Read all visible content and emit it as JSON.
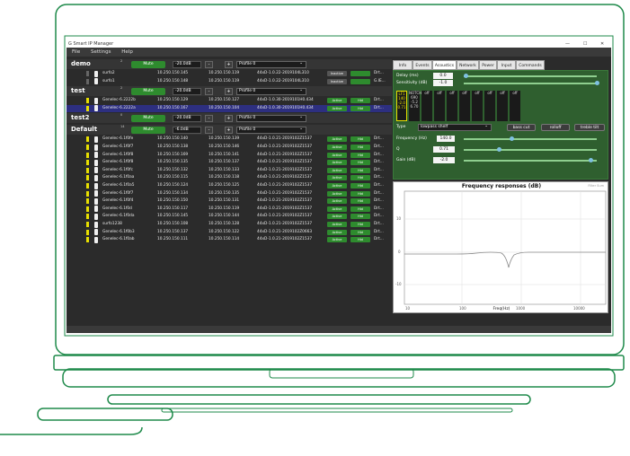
{
  "window": {
    "title": "Smart IP Manager",
    "controls": [
      "—",
      "☐",
      "✕"
    ]
  },
  "menu": [
    "File",
    "Settings",
    "Help"
  ],
  "groups": [
    {
      "name": "demo",
      "count": "2",
      "gain": "-20.0dB",
      "profile": "Profile 0",
      "devices": [
        {
          "name": "surfo2",
          "ip": "10.250.150.145",
          "ip2": "10.250.150.119",
          "fw": "44xD-1.0.22-2019104L310",
          "status1": "Inactive",
          "status2": "",
          "more": "Drt..."
        },
        {
          "name": "surfo1",
          "ip": "10.250.150.148",
          "ip2": "10.250.150.119",
          "fw": "44xD-1.0.22-2019104L310",
          "status1": "Inactive",
          "status2": "",
          "more": "G.IE..."
        }
      ]
    },
    {
      "name": "test",
      "count": "2",
      "gain": "-20.0dB",
      "profile": "Profile 0",
      "devices": [
        {
          "name": "Genelec-6.2222b",
          "ip": "10.250.150.129",
          "ip2": "10.250.150.127",
          "fw": "44xD-1.0.30-2019101H0.434",
          "status1": "Active",
          "status2": "Hid",
          "more": "Drt..."
        },
        {
          "name": "Genelec-6.2222a",
          "ip": "10.250.150.167",
          "ip2": "10.250.150.104",
          "fw": "44xD-1.0.30-2019101H0.434",
          "status1": "Active",
          "status2": "Hid",
          "more": "Drt..."
        }
      ]
    },
    {
      "name": "test2",
      "count": "0",
      "gain": "-20.0dB",
      "profile": "Profile 0",
      "devices": []
    },
    {
      "name": "Default",
      "count": "14",
      "gain": "-6.0dB",
      "profile": "Profile 0",
      "devices": [
        {
          "name": "Genelec-6.1f0fe",
          "ip": "10.250.150.140",
          "ip2": "10.250.150.139",
          "fw": "44xD-1.0.21-2019102Z1537",
          "status1": "Active",
          "status2": "Hid",
          "more": "Drt..."
        },
        {
          "name": "Genelec-6.1f0f7",
          "ip": "10.250.150.138",
          "ip2": "10.250.150.146",
          "fw": "44xD-1.0.21-2019102Z1537",
          "status1": "Active",
          "status2": "Hid",
          "more": "Drt..."
        },
        {
          "name": "Genelec-6.1f0f8",
          "ip": "10.250.150.169",
          "ip2": "10.250.150.141",
          "fw": "44xD-1.0.21-2019102Z1537",
          "status1": "Active",
          "status2": "Hid",
          "more": "Drt..."
        },
        {
          "name": "Genelec-6.1f0f8",
          "ip": "10.250.150.135",
          "ip2": "10.250.150.137",
          "fw": "44xD-1.0.21-2019102Z1537",
          "status1": "Active",
          "status2": "Hid",
          "more": "Drt..."
        },
        {
          "name": "Genelec-6.1f0fc",
          "ip": "10.250.150.132",
          "ip2": "10.250.150.133",
          "fw": "44xD-1.0.21-2019102Z1537",
          "status1": "Active",
          "status2": "Hid",
          "more": "Drt..."
        },
        {
          "name": "Genelec-6.1f0aa",
          "ip": "10.250.150.115",
          "ip2": "10.250.150.118",
          "fw": "44xD-1.0.21-2019102Z1537",
          "status1": "Active",
          "status2": "Hid",
          "more": "Drt..."
        },
        {
          "name": "Genelec-6.1f0a5",
          "ip": "10.250.150.124",
          "ip2": "10.250.150.125",
          "fw": "44xD-1.0.21-2019102Z1537",
          "status1": "Active",
          "status2": "Hid",
          "more": "Drt..."
        },
        {
          "name": "Genelec-6.1f0f7",
          "ip": "10.250.150.134",
          "ip2": "10.250.150.135",
          "fw": "44xD-1.0.21-2019102Z1537",
          "status1": "Active",
          "status2": "Hid",
          "more": "Drt..."
        },
        {
          "name": "Genelec-6.1f0f4",
          "ip": "10.250.150.150",
          "ip2": "10.250.150.131",
          "fw": "44xD-1.0.21-2019102Z1537",
          "status1": "Active",
          "status2": "Hid",
          "more": "Drt..."
        },
        {
          "name": "Genelec-6.1f0d",
          "ip": "10.250.150.117",
          "ip2": "10.250.150.119",
          "fw": "44xD-1.0.21-2019102Z1537",
          "status1": "Active",
          "status2": "Hid",
          "more": "Drt..."
        },
        {
          "name": "Genelec-6.1f0da",
          "ip": "10.250.150.145",
          "ip2": "10.250.150.144",
          "fw": "44xD-1.0.21-2019102Z1537",
          "status1": "Active",
          "status2": "Hid",
          "more": "Drt..."
        },
        {
          "name": "surfo1238",
          "ip": "10.250.150.108",
          "ip2": "10.250.150.128",
          "fw": "44xD-1.0.21-2019102Z1537",
          "status1": "Active",
          "status2": "Hid",
          "more": "Drt..."
        },
        {
          "name": "Genelec-6.1f0b3",
          "ip": "10.250.150.137",
          "ip2": "10.250.150.122",
          "fw": "44xD-1.0.21-2019102Z0663",
          "status1": "Active",
          "status2": "Hid",
          "more": "Drt..."
        },
        {
          "name": "Genelec-6.1f0ab",
          "ip": "10.250.150.111",
          "ip2": "10.250.150.114",
          "fw": "44xD-1.0.21-2019102Z1537",
          "status1": "Active",
          "status2": "Hid",
          "more": "Drt..."
        }
      ]
    }
  ],
  "labels": {
    "mute": "Mute",
    "minus": "-",
    "plus": "+"
  },
  "right": {
    "tabs": [
      "Info",
      "Events",
      "Acoustics",
      "Network",
      "Power",
      "Input",
      "Commands"
    ],
    "delay_label": "Delay (ms)",
    "delay_value": "0.0",
    "delay_level": 0,
    "sens_label": "Sensitivity (dB)",
    "sens_value": "-1.0",
    "sens_level": 1,
    "filters": [
      {
        "name": "LF1",
        "lines": [
          "140",
          "-2.0",
          "0.71"
        ],
        "active": true
      },
      {
        "name": "NOTCH",
        "lines": [
          "690",
          "-5.2",
          "6.70"
        ],
        "active": false
      },
      {
        "name": "off",
        "lines": [],
        "active": false
      },
      {
        "name": "off",
        "lines": [],
        "active": false
      },
      {
        "name": "off",
        "lines": [],
        "active": false
      },
      {
        "name": "off",
        "lines": [],
        "active": false
      },
      {
        "name": "off",
        "lines": [],
        "active": false
      },
      {
        "name": "off",
        "lines": [],
        "active": false
      },
      {
        "name": "off",
        "lines": [],
        "active": false
      },
      {
        "name": "off",
        "lines": [],
        "active": false
      }
    ],
    "type_label": "Type",
    "type_value": "lowpass shelf",
    "bass_btn": "bass cut",
    "rolloff_btn": "rolloff",
    "treble_btn": "treble tilt",
    "freq_label": "Frequency (Hz)",
    "freq_value": "140.0",
    "freq_level": 0.35,
    "q_label": "Q",
    "q_value": "0.71",
    "q_level": 0.25,
    "gain_label": "Gain (dB)",
    "gain_value": "-2.0",
    "gain_level": 0.95,
    "chart": {
      "title": "Frequency responses (dB)",
      "corner": "Filter Sum",
      "yticks": [
        "10",
        "0",
        "-10"
      ],
      "xticks": [
        "10",
        "100",
        "1000",
        "10000"
      ],
      "xlabel": "Freq(Hz)"
    }
  }
}
